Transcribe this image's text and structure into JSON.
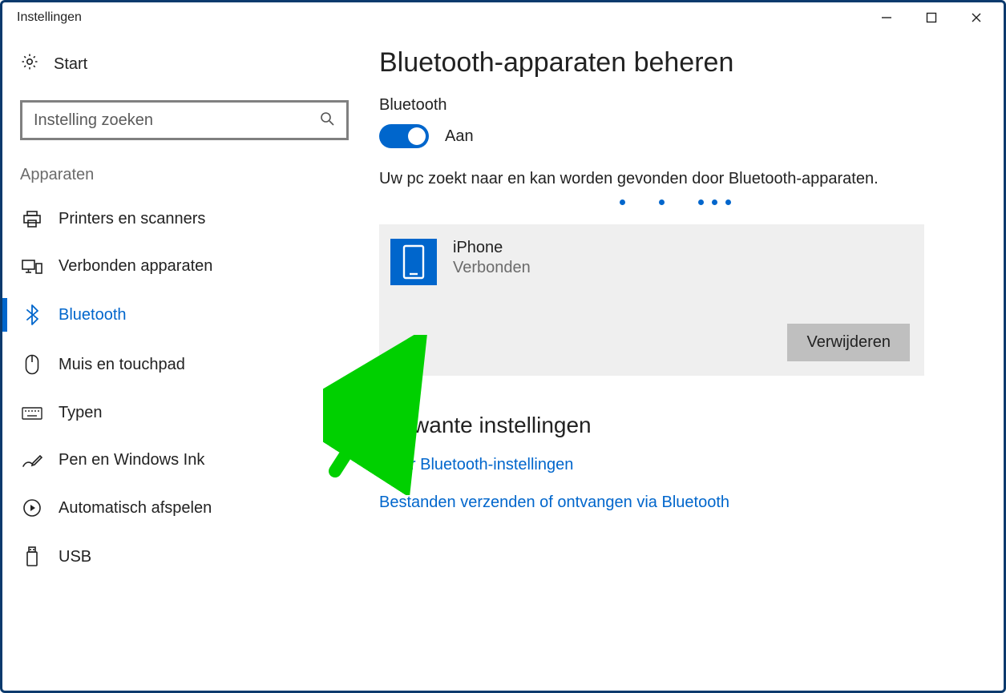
{
  "window": {
    "title": "Instellingen"
  },
  "sidebar": {
    "start": "Start",
    "search_placeholder": "Instelling zoeken",
    "section": "Apparaten",
    "items": [
      {
        "label": "Printers en scanners",
        "icon": "printer"
      },
      {
        "label": "Verbonden apparaten",
        "icon": "connected-devices"
      },
      {
        "label": "Bluetooth",
        "icon": "bluetooth",
        "active": true
      },
      {
        "label": "Muis en touchpad",
        "icon": "mouse"
      },
      {
        "label": "Typen",
        "icon": "keyboard"
      },
      {
        "label": "Pen en Windows Ink",
        "icon": "pen"
      },
      {
        "label": "Automatisch afspelen",
        "icon": "autoplay"
      },
      {
        "label": "USB",
        "icon": "usb"
      }
    ]
  },
  "main": {
    "title": "Bluetooth-apparaten beheren",
    "toggle_section_label": "Bluetooth",
    "toggle_state_label": "Aan",
    "toggle_on": true,
    "status_text": "Uw pc zoekt naar en kan worden gevonden door Bluetooth-apparaten.",
    "device": {
      "name": "iPhone",
      "status": "Verbonden",
      "remove_label": "Verwijderen"
    },
    "related_title": "Verwante instellingen",
    "links": [
      "Meer Bluetooth-instellingen",
      "Bestanden verzenden of ontvangen via Bluetooth"
    ]
  },
  "annotation": {
    "arrow_color": "#00d000"
  }
}
